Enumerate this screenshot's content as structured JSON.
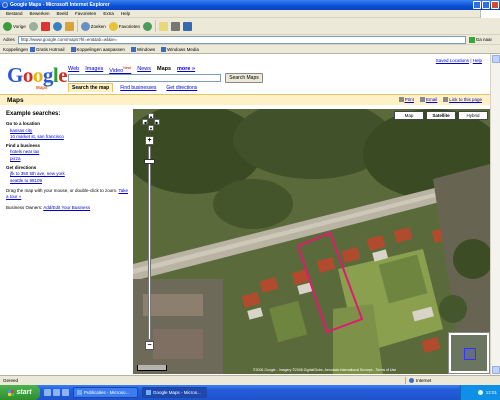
{
  "window": {
    "title": "Google Maps - Microsoft Internet Explorer"
  },
  "menu": [
    "Bestand",
    "Bewerken",
    "Beeld",
    "Favorieten",
    "Extra",
    "Help"
  ],
  "toolbar": {
    "back_label": "Vorige",
    "search_label": "Zoeken",
    "favorites_label": "Favorieten"
  },
  "address": {
    "label": "Adres",
    "url": "http://www.google.com/maps?hl=en&tab=wl&ie=",
    "go_label": "Ga naar"
  },
  "links": {
    "label": "Koppelingen",
    "items": [
      "Gratis Hotmail",
      "Koppelingen aanpassen",
      "Windows",
      "Windows Media"
    ]
  },
  "page": {
    "top_links": [
      "Saved Locations",
      "Help"
    ],
    "logo_sub": "Maps",
    "nav": [
      {
        "label": "Web",
        "active": false
      },
      {
        "label": "Images",
        "active": false
      },
      {
        "label": "Video",
        "active": false,
        "badge": "New!"
      },
      {
        "label": "News",
        "active": false
      },
      {
        "label": "Maps",
        "active": true
      },
      {
        "label": "more »",
        "active": false
      }
    ],
    "search_button": "Search Maps",
    "tabs": [
      "Search the map",
      "Find businesses",
      "Get directions"
    ],
    "section_title": "Maps",
    "actions": [
      "Print",
      "Email",
      "Link to this page"
    ]
  },
  "sidebar": {
    "heading": "Example searches:",
    "goto_title": "Go to a location",
    "goto_examples": [
      "kansas city",
      "10 market st, san francisco"
    ],
    "business_title": "Find a business",
    "business_examples": [
      "hotels near lax",
      "pizza"
    ],
    "directions_title": "Get directions",
    "directions_examples": [
      "jfk to 350 5th ave, new york",
      "seattle to 98109"
    ],
    "drag_text": "Drag the map with your mouse, or double-click to zoom.",
    "tour_link": "Take a tour »",
    "owners_label": "Business Owners:",
    "owners_link": "Add/Edit Your Business"
  },
  "map": {
    "types": [
      "Map",
      "Satellite",
      "Hybrid"
    ],
    "selected_type": "Satellite",
    "copyright": "©2006 Google - Imagery ©2006 DigitalGlobe, Aerodata International Surveys - Terms of Use"
  },
  "status": {
    "text": "Gereed",
    "zone": "Internet"
  },
  "taskbar": {
    "start": "start",
    "tasks": [
      "Publicaties - Microso...",
      "Google Maps - Micros..."
    ],
    "clock": "12:01"
  },
  "colors": {
    "titlebar": "#0a4fd4",
    "maps_bar": "#fff1c6",
    "highlight_outline": "#e01a6e"
  }
}
